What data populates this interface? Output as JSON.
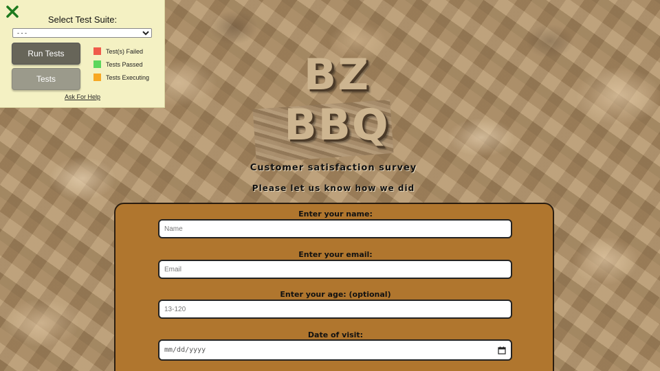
{
  "test_panel": {
    "close_icon": "close-x-icon",
    "suite_label": "Select Test Suite:",
    "suite_selected": "- - -",
    "run_button": "Run Tests",
    "tests_button": "Tests",
    "legend": [
      {
        "label": "Test(s) Failed",
        "color": "#f05a4a"
      },
      {
        "label": "Tests Passed",
        "color": "#5cd65c"
      },
      {
        "label": "Tests Executing",
        "color": "#f7a823"
      }
    ],
    "help_link": "Ask For Help"
  },
  "header": {
    "brand": "BZ BBQ",
    "title": "Customer satisfaction survey",
    "subtitle": "Please let us know how we did"
  },
  "form": {
    "name_label": "Enter your name:",
    "name_placeholder": "Name",
    "email_label": "Enter your email:",
    "email_placeholder": "Email",
    "age_label": "Enter your age: (optional)",
    "age_placeholder": "13-120",
    "date_label": "Date of visit:",
    "date_placeholder": "mm/dd/yyyy",
    "date_icon": "calendar-icon"
  }
}
